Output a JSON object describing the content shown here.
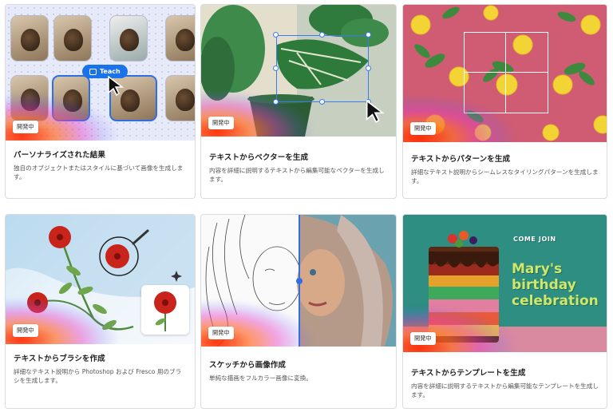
{
  "cards": [
    {
      "title": "パーソナライズされた結果",
      "desc": "独自のオブジェクトまたはスタイルに基づいて画像を生成します。",
      "badge": "開発中",
      "teach_label": "Teach"
    },
    {
      "title": "テキストからベクターを生成",
      "desc": "内容を詳細に説明するテキストから編集可能なベクターを生成します。",
      "badge": "開発中"
    },
    {
      "title": "テキストからパターンを生成",
      "desc": "詳細なテキスト説明からシームレスなタイリングパターンを生成します。",
      "badge": "開発中"
    },
    {
      "title": "テキストからブラシを作成",
      "desc": "詳細なテキスト説明から Photoshop および Fresco 用のブラシを生成します。",
      "badge": "開発中"
    },
    {
      "title": "スケッチから画像作成",
      "desc": "単純な描画をフルカラー画像に変換。",
      "badge": "開発中"
    },
    {
      "title": "テキストからテンプレートを生成",
      "desc": "内容を詳細に説明するテキストから編集可能なテンプレートを生成します。",
      "badge": "開発中",
      "art_text": {
        "kicker": "COME JOIN",
        "line1": "Mary's",
        "line2": "birthday",
        "line3": "celebration"
      }
    }
  ],
  "colors": {
    "accent": "#1a73e8",
    "selection": "#3a7bf0"
  }
}
